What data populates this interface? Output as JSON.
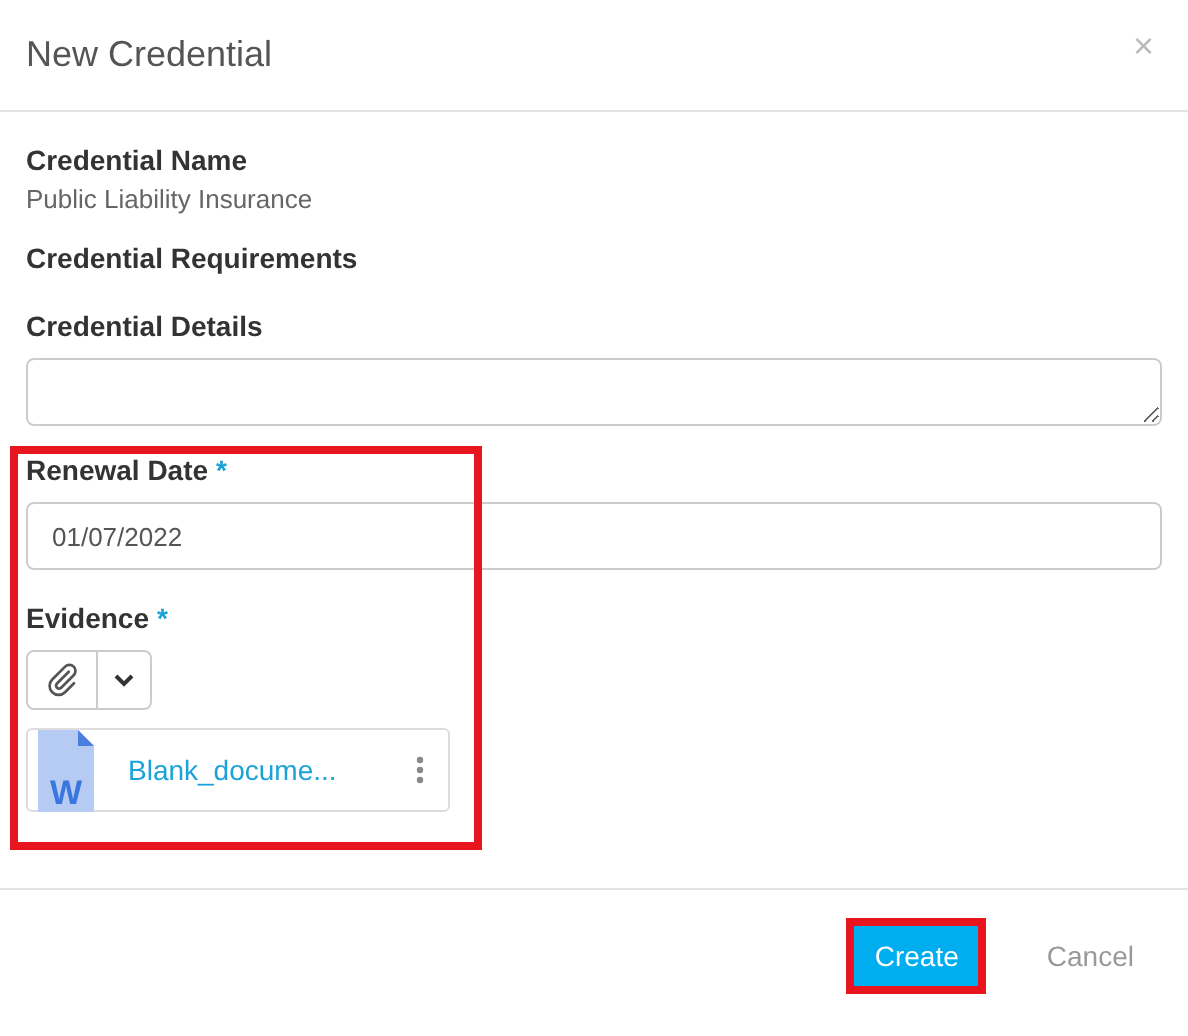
{
  "dialog": {
    "title": "New Credential",
    "close": "×"
  },
  "fields": [
    {
      "kind": "info",
      "label": "Credential Name",
      "value": "Public Liability Insurance"
    },
    {
      "kind": "heading",
      "label": "Credential Requirements"
    },
    {
      "kind": "textarea",
      "label": "Credential Details"
    },
    {
      "kind": "date",
      "label": "Renewal Date",
      "required": true,
      "required_mark": "*",
      "value": "01/07/2022"
    },
    {
      "kind": "attachments",
      "label": "Evidence",
      "required": true,
      "required_mark": "*",
      "files": [
        {
          "name": "Blank_docume...",
          "icon_letter": "W"
        }
      ]
    }
  ],
  "highlights": {
    "date_and_evidence": true,
    "create_button": true
  },
  "buttons": [
    {
      "kind": "primary",
      "label": "Create"
    },
    {
      "kind": "link",
      "label": "Cancel"
    }
  ]
}
